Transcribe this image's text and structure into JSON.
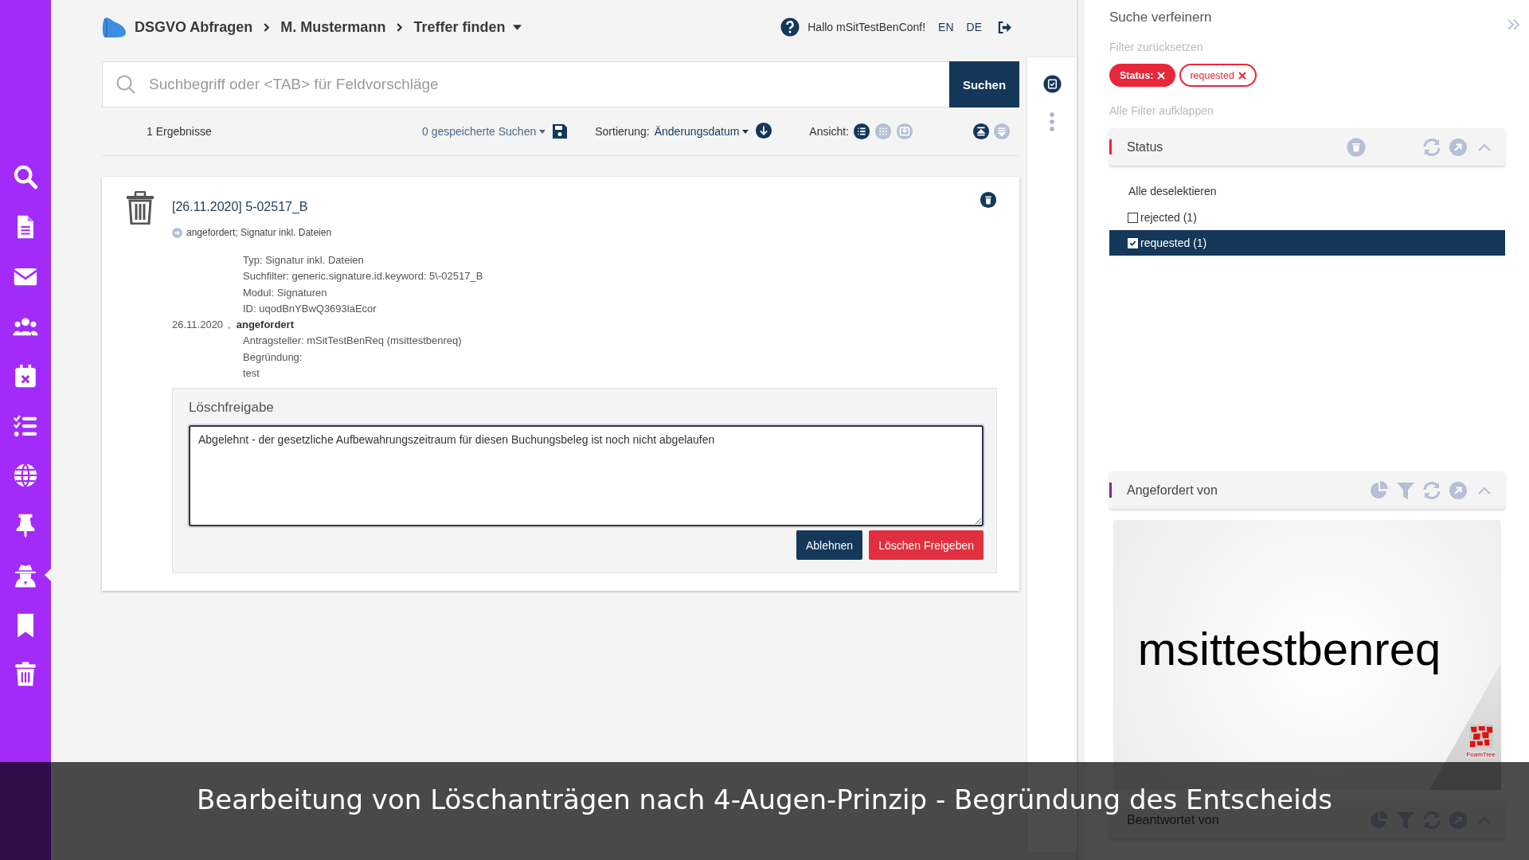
{
  "sidebar": {
    "items": [
      {
        "kind": "search",
        "selected": false
      },
      {
        "kind": "document",
        "selected": false
      },
      {
        "kind": "mail",
        "selected": false
      },
      {
        "kind": "users",
        "selected": false
      },
      {
        "kind": "calendar",
        "selected": false
      },
      {
        "kind": "checklist",
        "selected": false
      },
      {
        "kind": "globe",
        "selected": false
      },
      {
        "kind": "pin",
        "selected": false
      },
      {
        "kind": "spy",
        "selected": true
      },
      {
        "kind": "bookmark",
        "selected": false
      },
      {
        "kind": "trash",
        "selected": false
      }
    ]
  },
  "header": {
    "breadcrumb": [
      "DSGVO Abfragen",
      "M. Mustermann",
      "Treffer finden"
    ],
    "greeting": "Hallo mSitTestBenConf!",
    "languages": [
      "EN",
      "DE"
    ]
  },
  "search": {
    "placeholder": "Suchbegriff oder <TAB> für Feldvorschläge",
    "button": "Suchen"
  },
  "results_bar": {
    "count": "1 Ergebnisse",
    "saved_searches": "0 gespeicherte Suchen",
    "sort_label": "Sortierung:",
    "sort_value": "Änderungsdatum",
    "view_label": "Ansicht:",
    "views": [
      {
        "kind": "list",
        "selected": true
      },
      {
        "kind": "grid",
        "selected": false
      },
      {
        "kind": "export",
        "selected": false
      }
    ]
  },
  "result": {
    "title": "[26.11.2020] 5-02517_B",
    "summary": "angefordert; Signatur inkl. Dateien",
    "details": [
      "Typ: Signatur inkl. Dateien",
      "Suchfilter: generic.signature.id.keyword: 5\\-02517_B",
      "Modul: Signaturen",
      "ID: uqodBnYBwQ3693laEcor"
    ],
    "date": "26.11.2020",
    "separator": ",",
    "status": "angefordert",
    "request_lines": [
      "Antragsteller: mSitTestBenReq (msittestbenreq)",
      "Begründung:",
      "test"
    ],
    "release": {
      "title": "Löschfreigabe",
      "value": "Abgelehnt - der gesetzliche Aufbewahrungszeitraum für diesen Buchungsbeleg ist noch nicht abgelaufen",
      "buttons": [
        {
          "label": "Ablehnen",
          "kind": "primary"
        },
        {
          "label": "Löschen Freigeben",
          "kind": "danger"
        }
      ]
    }
  },
  "filters": {
    "title": "Suche verfeinern",
    "reset": "Filter zurücksetzen",
    "chips": [
      {
        "label": "Status:",
        "kind": "solid"
      },
      {
        "label": "requested",
        "kind": "outline"
      }
    ],
    "expand_all": "Alle Filter aufklappen",
    "groups": [
      {
        "title": "Status",
        "kind": "facet",
        "color": "#e8273b",
        "deselect": "Alle deselektieren",
        "options": [
          {
            "label": "rejected (1)",
            "checked": false,
            "selected": false
          },
          {
            "label": "requested (1)",
            "checked": true,
            "selected": true
          }
        ]
      },
      {
        "title": "Angefordert von",
        "kind": "cloud",
        "color": "#7b2d90",
        "cloud": {
          "words": [
            "msittestbenreq"
          ],
          "logo_text": "FoamTree"
        }
      },
      {
        "title": "Beantwortet von",
        "kind": "cloud"
      }
    ]
  },
  "caption": "Bearbeitung von Löschanträgen nach 4-Augen-Prinzip - Begründung des Entscheids"
}
